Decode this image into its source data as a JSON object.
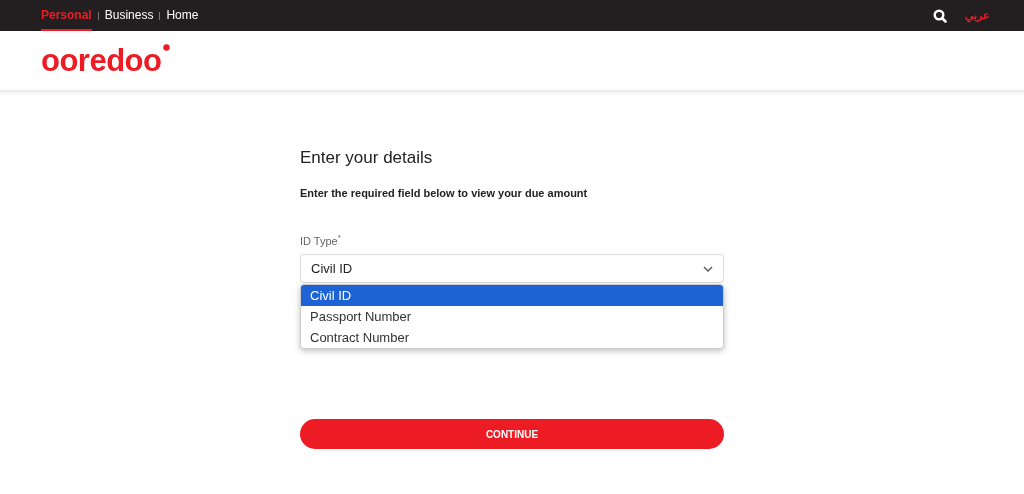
{
  "top_nav": {
    "links": [
      {
        "label": "Personal",
        "selected": true
      },
      {
        "label": "Business",
        "selected": false
      },
      {
        "label": "Home",
        "selected": false
      }
    ],
    "language": "عربي"
  },
  "header": {
    "logo": "ooredoo"
  },
  "form": {
    "title": "Enter your details",
    "subtitle": "Enter the required field below to view your due amount",
    "id_type": {
      "label": "ID Type",
      "required_mark": "*",
      "value": "Civil ID",
      "expanded": true,
      "options": [
        {
          "label": "Civil ID",
          "selected": true
        },
        {
          "label": "Passport Number",
          "selected": false
        },
        {
          "label": "Contract Number",
          "selected": false
        }
      ]
    },
    "button": "CONTINUE"
  }
}
